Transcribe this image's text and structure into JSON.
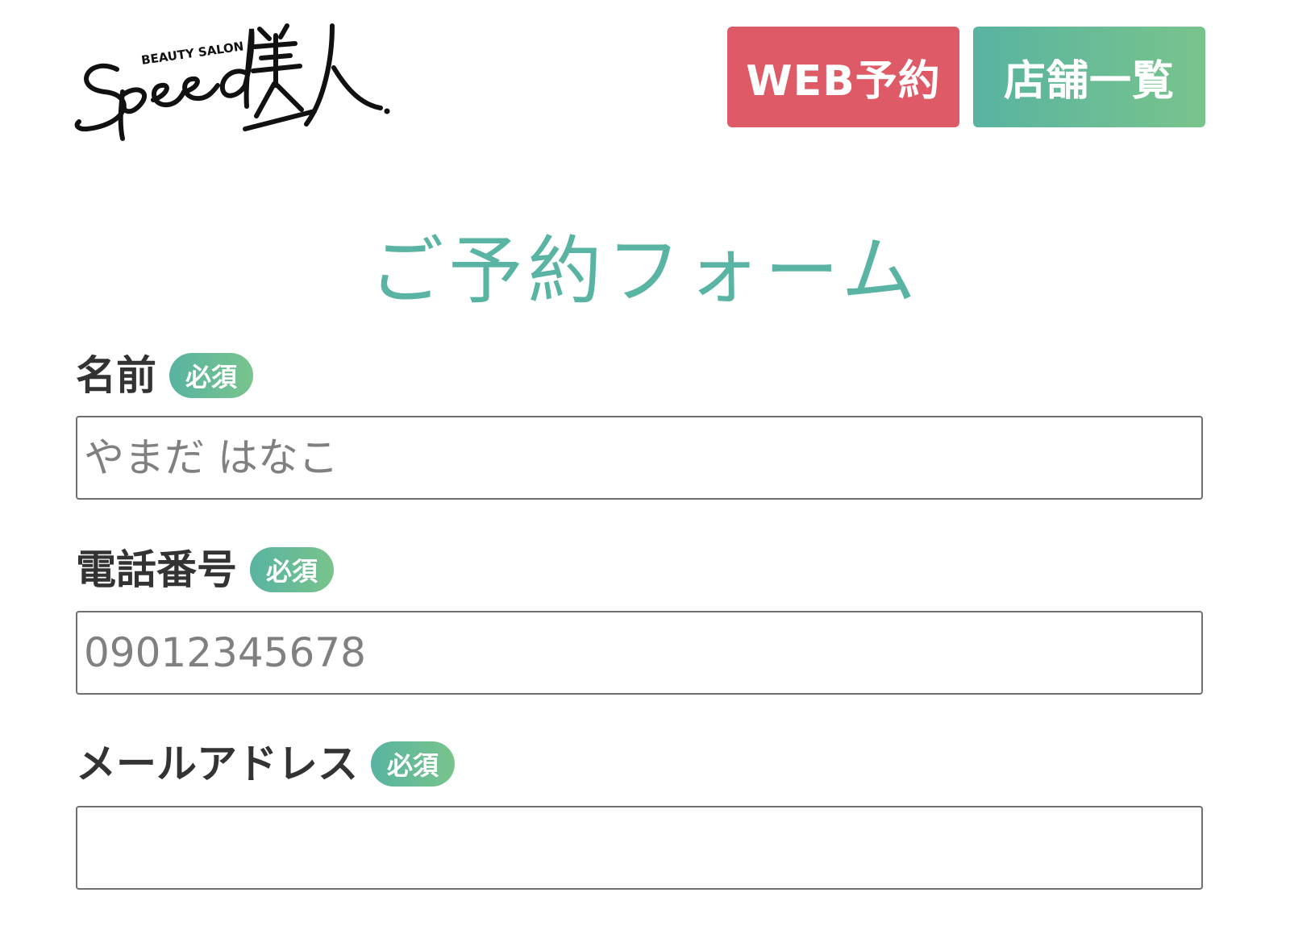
{
  "header": {
    "logo": {
      "brand": "Speed美人",
      "tagline": "BEAUTY SALON"
    },
    "buttons": {
      "web_reserve": "WEB予約",
      "shop_list": "店舗一覧"
    },
    "colors": {
      "web_reserve_bg": "#de5a66",
      "shop_list_bg": "#5ab4a3",
      "accent_green": "#79c48c"
    }
  },
  "form": {
    "title": "ご予約フォーム",
    "required_badge": "必須",
    "fields": [
      {
        "label": "名前",
        "placeholder": "やまだ はなこ",
        "value": ""
      },
      {
        "label": "電話番号",
        "placeholder": "09012345678",
        "value": ""
      },
      {
        "label": "メールアドレス",
        "placeholder": "",
        "value": ""
      }
    ]
  }
}
